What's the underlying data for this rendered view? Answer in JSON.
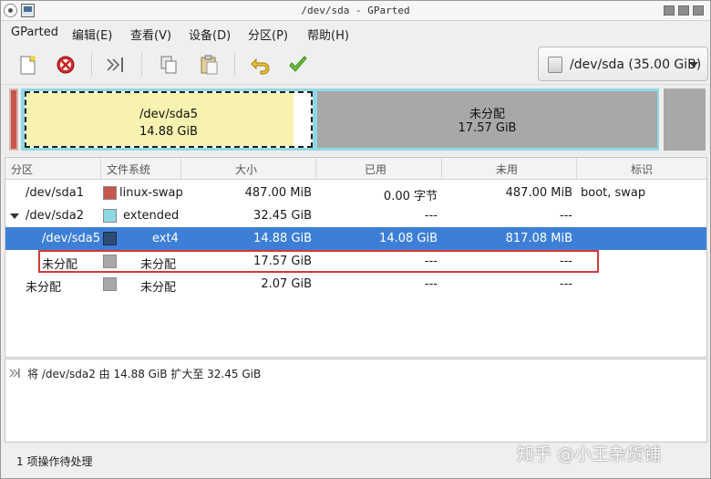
{
  "window": {
    "title": "/dev/sda - GParted"
  },
  "menu": [
    {
      "label": "GParted"
    },
    {
      "label": "编辑(E)"
    },
    {
      "label": "查看(V)"
    },
    {
      "label": "设备(D)"
    },
    {
      "label": "分区(P)"
    },
    {
      "label": "帮助(H)"
    }
  ],
  "toolbar": {
    "icons": [
      "new-partition-icon",
      "delete-icon",
      "resize-move-icon",
      "copy-icon",
      "paste-icon",
      "undo-icon",
      "apply-icon"
    ]
  },
  "device_selector": {
    "label": "/dev/sda (35.00 GiB)"
  },
  "disk_map": {
    "sda5": {
      "name": "/dev/sda5",
      "size": "14.88 GiB"
    },
    "unallocated": {
      "name": "未分配",
      "size": "17.57 GiB"
    }
  },
  "table": {
    "headers": [
      "分区",
      "文件系统",
      "大小",
      "已用",
      "未用",
      "标识"
    ],
    "rows": [
      {
        "partition": "/dev/sda1",
        "fs": "linux-swap",
        "size": "487.00 MiB",
        "used": "0.00 字节",
        "unused": "487.00 MiB",
        "flags": "boot, swap",
        "color": "#c6574c"
      },
      {
        "partition": "/dev/sda2",
        "fs": "extended",
        "size": "32.45 GiB",
        "used": "---",
        "unused": "---",
        "flags": "",
        "color": "#8fd9e3"
      },
      {
        "partition": "/dev/sda5",
        "fs": "ext4",
        "size": "14.88 GiB",
        "used": "14.08 GiB",
        "unused": "817.08 MiB",
        "flags": "",
        "color": "#2d4d73"
      },
      {
        "partition": "未分配",
        "fs": "未分配",
        "size": "17.57 GiB",
        "used": "---",
        "unused": "---",
        "flags": "",
        "color": "#a8a8a8"
      },
      {
        "partition": "未分配",
        "fs": "未分配",
        "size": "2.07 GiB",
        "used": "---",
        "unused": "---",
        "flags": "",
        "color": "#a8a8a8"
      }
    ]
  },
  "pending_ops": [
    {
      "text": "将 /dev/sda2 由 14.88 GiB 扩大至 32.45 GiB"
    }
  ],
  "status": {
    "text": "1 项操作待处理"
  },
  "watermark": {
    "text": "知乎 @小王杂货铺"
  }
}
